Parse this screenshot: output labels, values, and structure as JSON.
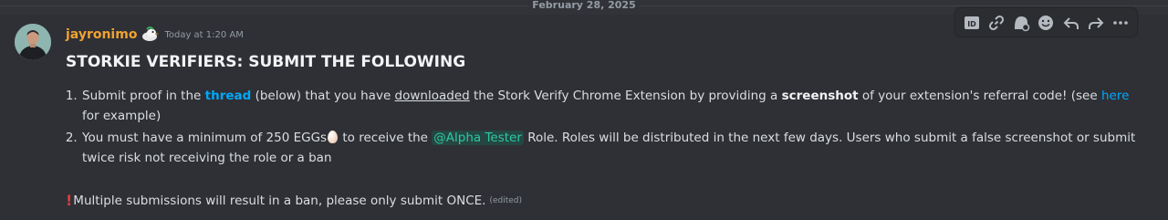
{
  "divider": {
    "date": "February 28, 2025"
  },
  "message": {
    "author": "jayronimo",
    "timestamp": "Today at 1:20 AM",
    "title": "STORKIE VERIFIERS: SUBMIT THE FOLLOWING",
    "items": [
      {
        "p1": "Submit proof in the ",
        "thread": "thread",
        "p2": " (below) that you have ",
        "downloaded": "downloaded",
        "p3": " the Stork Verify Chrome Extension by providing a ",
        "screenshot": "screenshot",
        "p4": " of your extension's referral code! (see ",
        "here": "here",
        "p5": " for example)"
      },
      {
        "p1": "You must have a minimum of 250 EGGs",
        "p2": " to receive the ",
        "mention": "@Alpha Tester",
        "p3": " Role. Roles will be distributed in the next few days. Users who submit a false screenshot or submit twice risk not receiving the role or a ban"
      }
    ],
    "warning": "Multiple submissions will result in a ban, please only submit ONCE.",
    "edited": "(edited)"
  },
  "toolbar": {
    "buttons": [
      "id-icon",
      "link-icon",
      "create-thread-icon",
      "add-reaction-icon",
      "reply-icon",
      "forward-icon",
      "more-icon"
    ]
  },
  "colors": {
    "background": "#313338",
    "username": "#f0a232",
    "link": "#00a8fc",
    "mention": "#2dc9a4",
    "warning": "#e03b3b"
  }
}
